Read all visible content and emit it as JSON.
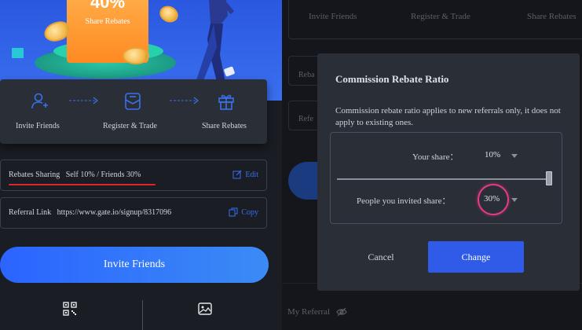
{
  "hero": {
    "percent": "40%",
    "label": "Share Rebates"
  },
  "steps": [
    {
      "label": "Invite Friends",
      "icon": "user-add-icon"
    },
    {
      "label": "Register & Trade",
      "icon": "document-icon"
    },
    {
      "label": "Share Rebates",
      "icon": "gift-icon"
    }
  ],
  "rebates": {
    "text": "Rebates Sharing   Self 10% / Friends 30%",
    "action": "Edit"
  },
  "referral": {
    "text": "Referral Link   https://www.gate.io/signup/8317096",
    "action": "Copy"
  },
  "invite_button": "Invite Friends",
  "right": {
    "tabs": [
      "Invite Friends",
      "Register & Trade",
      "Share Rebates"
    ],
    "ghost_rows": [
      "Reba",
      "Refe"
    ],
    "my_referral": "My Referral"
  },
  "modal": {
    "title": "Commission Rebate Ratio",
    "description": "Commission rebate ratio applies to new referrals only, it does not apply to existing ones.",
    "your_share_label": "Your share：",
    "your_share_value": "10%",
    "invited_share_label": "People you invited share：",
    "invited_share_value": "30%",
    "slider_fraction": 1.0,
    "cancel": "Cancel",
    "change": "Change"
  },
  "colors": {
    "accent": "#2f5be8",
    "highlight": "#e83a8a",
    "underline": "#e0242f"
  }
}
